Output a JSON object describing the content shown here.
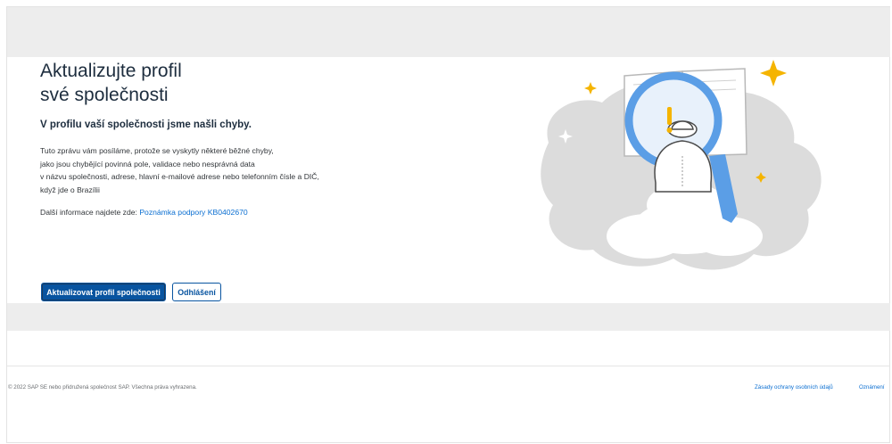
{
  "page": {
    "title_line1": "Aktualizujte profil",
    "title_line2": "své společnosti",
    "subtitle": "V profilu vaší společnosti jsme našli chyby.",
    "body_lines": [
      "Tuto zprávu vám posíláme, protože se vyskytly některé běžné chyby,",
      "jako jsou chybějící povinná pole, validace nebo nesprávná data",
      "v názvu společnosti, adrese, hlavní e-mailové adrese nebo telefonním čísle a DIČ,",
      "když jde o Brazílii"
    ],
    "info_prefix": "Další informace najdete zde:",
    "info_link": "Poznámka podpory KB0402670"
  },
  "actions": {
    "primary_label": "Aktualizovat profil společnosti",
    "secondary_label": "Odhlášení"
  },
  "footer": {
    "copyright": "© 2022 SAP SE nebo přidružená společnost SAP. Všechna práva vyhrazena.",
    "privacy_link": "Zásady ochrany osobních údajů",
    "notices_link": "Oznámení"
  },
  "colors": {
    "accent": "#0854a0",
    "link": "#0a6ed1",
    "band": "#ededed",
    "star": "#f5b400",
    "lens": "#5b9ee6"
  },
  "icons": [
    "detective-book-illustration",
    "sparkle-star-icon",
    "exclamation-icon"
  ]
}
